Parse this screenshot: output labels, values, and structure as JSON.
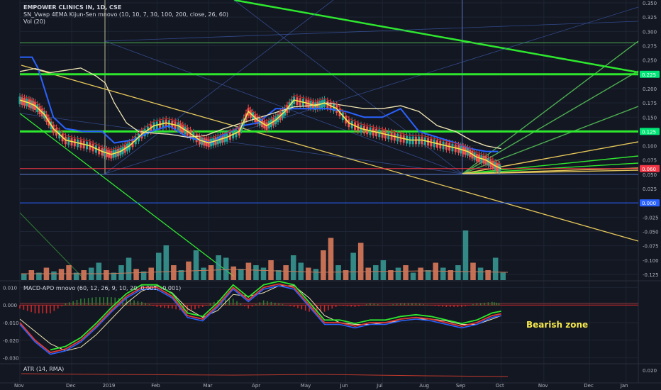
{
  "chart_data": {
    "type": "line",
    "title": "EMPOWER CLINICS IN, 1D, CSE",
    "indicator_labels": [
      "SN_Vwap 4EMA Kijun-Sen mnovo (10, 10, 7, 30, 100, 200, close, 26, 60)",
      "Vol (20)"
    ],
    "price_axis": {
      "ticks": [
        "0.350",
        "0.325",
        "0.300",
        "0.275",
        "0.250",
        "0.225",
        "0.200",
        "0.175",
        "0.150",
        "0.125",
        "0.100",
        "0.075",
        "0.050",
        "0.025",
        "0.000",
        "-0.025",
        "-0.050",
        "-0.075",
        "-0.100",
        "-0.125"
      ],
      "ylim": [
        -0.135,
        0.355
      ]
    },
    "x_axis": {
      "tick_labels": [
        "Nov",
        "Dec",
        "2019",
        "Feb",
        "Mar",
        "Apr",
        "May",
        "Jun",
        "Jul",
        "Aug",
        "Sep",
        "Oct",
        "Nov",
        "Dec",
        "Jan"
      ],
      "tick_positions": [
        0.5,
        2.2,
        3.4,
        5.0,
        6.7,
        8.3,
        9.9,
        11.2,
        12.4,
        13.8,
        15.0,
        16.3,
        17.7,
        19.2,
        20.4
      ],
      "xlim": [
        0.5,
        20.8
      ]
    },
    "price_badges": [
      {
        "value": 0.225,
        "text": "0.225",
        "color": "#00e676"
      },
      {
        "value": 0.125,
        "text": "0.125",
        "color": "#00e676"
      },
      {
        "value": 0.06,
        "text": "0.060",
        "color": "#f23645"
      },
      {
        "value": 0.0,
        "text": "0.000",
        "color": "#2962ff"
      }
    ],
    "horizontal_levels": [
      {
        "value": 0.225,
        "color": "#2ee82e",
        "width": 3
      },
      {
        "value": 0.125,
        "color": "#2ee82e",
        "width": 3
      },
      {
        "value": 0.28,
        "color": "#4caf50",
        "width": 1
      },
      {
        "value": 0.06,
        "color": "#f23645",
        "width": 1
      },
      {
        "value": 0.05,
        "color": "#5b7bd6",
        "width": 1
      },
      {
        "value": 0.0,
        "color": "#2962ff",
        "width": 1
      }
    ],
    "price_series": {
      "name": "close",
      "x": [
        0.5,
        0.8,
        1.0,
        1.3,
        1.6,
        2.0,
        2.4,
        2.8,
        3.2,
        3.5,
        3.8,
        4.1,
        4.5,
        4.9,
        5.3,
        5.7,
        6.0,
        6.4,
        6.7,
        7.0,
        7.3,
        7.7,
        8.0,
        8.3,
        8.6,
        8.9,
        9.2,
        9.5,
        9.9,
        10.2,
        10.5,
        10.9,
        11.3,
        11.7,
        12.1,
        12.5,
        12.9,
        13.3,
        13.7,
        14.1,
        14.5,
        14.9,
        15.2,
        15.5,
        15.8,
        16.1,
        16.3
      ],
      "y": [
        0.18,
        0.175,
        0.17,
        0.155,
        0.13,
        0.11,
        0.105,
        0.1,
        0.09,
        0.085,
        0.09,
        0.1,
        0.12,
        0.135,
        0.14,
        0.135,
        0.125,
        0.11,
        0.105,
        0.11,
        0.115,
        0.125,
        0.16,
        0.145,
        0.135,
        0.145,
        0.16,
        0.18,
        0.175,
        0.17,
        0.175,
        0.165,
        0.14,
        0.13,
        0.125,
        0.12,
        0.115,
        0.11,
        0.11,
        0.105,
        0.1,
        0.095,
        0.09,
        0.08,
        0.075,
        0.065,
        0.06
      ]
    },
    "kijun_series": {
      "name": "Kijun-Sen",
      "x": [
        0.5,
        0.9,
        1.1,
        1.6,
        2.0,
        2.6,
        3.2,
        3.6,
        4.2,
        4.8,
        5.4,
        6.0,
        6.8,
        7.2,
        7.8,
        8.3,
        8.9,
        9.4,
        10.0,
        10.6,
        11.2,
        11.8,
        12.4,
        13.0,
        13.6,
        14.2,
        14.8,
        15.3,
        15.8,
        16.2
      ],
      "y": [
        0.255,
        0.255,
        0.235,
        0.15,
        0.13,
        0.125,
        0.125,
        0.105,
        0.11,
        0.125,
        0.135,
        0.115,
        0.105,
        0.12,
        0.135,
        0.14,
        0.165,
        0.165,
        0.165,
        0.165,
        0.16,
        0.15,
        0.15,
        0.165,
        0.125,
        0.115,
        0.105,
        0.095,
        0.09,
        0.09
      ]
    },
    "sma_series": {
      "name": "MA slow",
      "x": [
        0.5,
        1.0,
        1.5,
        2.0,
        2.5,
        3.0,
        3.3,
        3.6,
        4.0,
        4.4,
        4.9,
        5.4,
        6.0,
        6.6,
        7.2,
        7.8,
        8.4,
        9.0,
        9.5,
        10.0,
        10.6,
        11.2,
        11.8,
        12.4,
        13.0,
        13.6,
        14.2,
        14.8,
        15.3,
        15.8,
        16.3
      ],
      "y": [
        0.23,
        0.235,
        0.228,
        0.232,
        0.236,
        0.222,
        0.21,
        0.175,
        0.14,
        0.125,
        0.122,
        0.12,
        0.115,
        0.118,
        0.13,
        0.14,
        0.15,
        0.16,
        0.168,
        0.17,
        0.175,
        0.17,
        0.165,
        0.165,
        0.17,
        0.16,
        0.135,
        0.125,
        0.11,
        0.1,
        0.095
      ]
    },
    "volume": [
      5,
      8,
      6,
      10,
      7,
      9,
      12,
      6,
      8,
      10,
      14,
      8,
      6,
      12,
      18,
      9,
      7,
      10,
      22,
      28,
      12,
      8,
      15,
      24,
      10,
      12,
      20,
      18,
      11,
      9,
      14,
      12,
      10,
      16,
      8,
      12,
      20,
      14,
      10,
      9,
      24,
      34,
      12,
      8,
      22,
      30,
      10,
      12,
      16,
      8,
      10,
      12,
      6,
      10,
      8,
      14,
      10,
      8,
      12,
      40,
      14,
      10,
      8,
      18,
      6
    ],
    "volume_colors": [
      "g",
      "r",
      "g",
      "r",
      "g",
      "r",
      "r",
      "g",
      "r",
      "g",
      "g",
      "r",
      "g",
      "g",
      "g",
      "r",
      "g",
      "r",
      "g",
      "g",
      "r",
      "g",
      "r",
      "g",
      "g",
      "r",
      "g",
      "g",
      "r",
      "g",
      "r",
      "g",
      "g",
      "r",
      "g",
      "r",
      "g",
      "g",
      "r",
      "g",
      "r",
      "r",
      "g",
      "r",
      "g",
      "r",
      "r",
      "g",
      "g",
      "r",
      "g",
      "r",
      "g",
      "r",
      "g",
      "r",
      "g",
      "r",
      "g",
      "g",
      "r",
      "g",
      "r",
      "g",
      "g"
    ],
    "macd_panel": {
      "label": "MACD-APO mnovo (60, 12, 26, 9, 10, 20, 0.001, -0.001)",
      "ticks": [
        "0.010",
        "0.000",
        "-0.010",
        "-0.020",
        "-0.030"
      ],
      "ylim": [
        -0.033,
        0.013
      ],
      "annotation": "Bearish zone",
      "fast": {
        "x": [
          0.5,
          1.0,
          1.5,
          2.0,
          2.5,
          3.0,
          3.5,
          4.0,
          4.5,
          5.0,
          5.5,
          6.0,
          6.5,
          7.0,
          7.5,
          8.0,
          8.5,
          9.0,
          9.5,
          10.0,
          10.5,
          11.0,
          11.5,
          12.0,
          12.5,
          13.0,
          13.5,
          14.0,
          14.5,
          15.0,
          15.5,
          16.0,
          16.3
        ],
        "y": [
          -0.01,
          -0.02,
          -0.027,
          -0.025,
          -0.02,
          -0.012,
          -0.003,
          0.005,
          0.01,
          0.01,
          0.005,
          -0.006,
          -0.008,
          0.0,
          0.01,
          0.003,
          0.01,
          0.012,
          0.01,
          0.0,
          -0.01,
          -0.01,
          -0.012,
          -0.01,
          -0.01,
          -0.008,
          -0.007,
          -0.008,
          -0.01,
          -0.012,
          -0.01,
          -0.006,
          -0.005
        ]
      },
      "signal": {
        "x": [
          0.5,
          1.0,
          1.5,
          2.0,
          2.5,
          3.0,
          3.5,
          4.0,
          4.5,
          5.0,
          5.5,
          6.0,
          6.5,
          7.0,
          7.5,
          8.0,
          8.5,
          9.0,
          9.5,
          10.0,
          10.5,
          11.0,
          11.5,
          12.0,
          12.5,
          13.0,
          13.5,
          14.0,
          14.5,
          15.0,
          15.5,
          16.0,
          16.3
        ],
        "y": [
          -0.008,
          -0.015,
          -0.022,
          -0.026,
          -0.024,
          -0.017,
          -0.008,
          0.001,
          0.008,
          0.011,
          0.007,
          -0.002,
          -0.007,
          -0.003,
          0.006,
          0.005,
          0.007,
          0.011,
          0.011,
          0.004,
          -0.006,
          -0.01,
          -0.011,
          -0.011,
          -0.01,
          -0.009,
          -0.008,
          -0.008,
          -0.009,
          -0.011,
          -0.011,
          -0.008,
          -0.006
        ]
      }
    },
    "atr_panel": {
      "label": "ATR (14, RMA)",
      "ticks": [
        "0.020"
      ],
      "ylim": [
        0.0,
        0.03
      ]
    }
  },
  "colors": {
    "background": "#131722",
    "up": "#26a69a",
    "down": "#ef5350",
    "green_level": "#2ee82e",
    "blue": "#2962ff",
    "yellow": "#f6e94a"
  }
}
